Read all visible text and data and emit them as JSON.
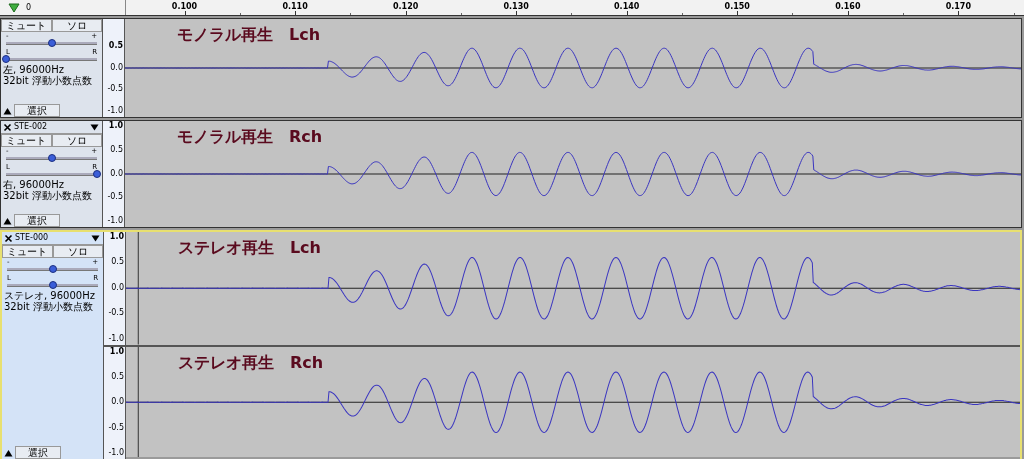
{
  "ruler": {
    "start_label": "0",
    "ticks": [
      "0.100",
      "0.110",
      "0.120",
      "0.130",
      "0.140",
      "0.150",
      "0.160",
      "0.170"
    ]
  },
  "tracks": [
    {
      "kind": "mono",
      "focused": false,
      "cursor_line": false,
      "mute_label": "ミュート",
      "solo_label": "ソロ",
      "gain": {
        "min_label": "-",
        "max_label": "+",
        "level": 0.5
      },
      "pan": {
        "min_label": "L",
        "max_label": "R",
        "level": 0
      },
      "info": [
        "左, 96000Hz",
        "32bit 浮動小数点数"
      ],
      "select_label": "選択",
      "channels": [
        {
          "label": "モノラル再生　Lch",
          "scale": [
            "0.5",
            "0.0",
            "-0.5",
            "-1.0"
          ]
        }
      ]
    },
    {
      "kind": "mono",
      "name": "STE-002",
      "focused": false,
      "cursor_line": false,
      "mute_label": "ミュート",
      "solo_label": "ソロ",
      "gain": {
        "min_label": "-",
        "max_label": "+",
        "level": 0.5
      },
      "pan": {
        "min_label": "L",
        "max_label": "R",
        "level": 1
      },
      "info": [
        "右, 96000Hz",
        "32bit 浮動小数点数"
      ],
      "select_label": "選択",
      "channels": [
        {
          "label": "モノラル再生　Rch",
          "scale": [
            "1.0",
            "0.5",
            "0.0",
            "-0.5",
            "-1.0"
          ]
        }
      ]
    },
    {
      "kind": "stereo",
      "name": "STE-000",
      "focused": true,
      "cursor_line": true,
      "mute_label": "ミュート",
      "solo_label": "ソロ",
      "gain": {
        "min_label": "-",
        "max_label": "+",
        "level": 0.5
      },
      "pan": {
        "min_label": "L",
        "max_label": "R",
        "level": 0.5
      },
      "info": [
        "ステレオ, 96000Hz",
        "32bit 浮動小数点数"
      ],
      "select_label": "選択",
      "channels": [
        {
          "label": "ステレオ再生　Lch",
          "scale": [
            "1.0",
            "0.5",
            "0.0",
            "-0.5",
            "-1.0"
          ]
        },
        {
          "label": "ステレオ再生　Rch",
          "scale": [
            "1.0",
            "0.5",
            "0.0",
            "-0.5",
            "-1.0"
          ]
        }
      ]
    }
  ]
}
